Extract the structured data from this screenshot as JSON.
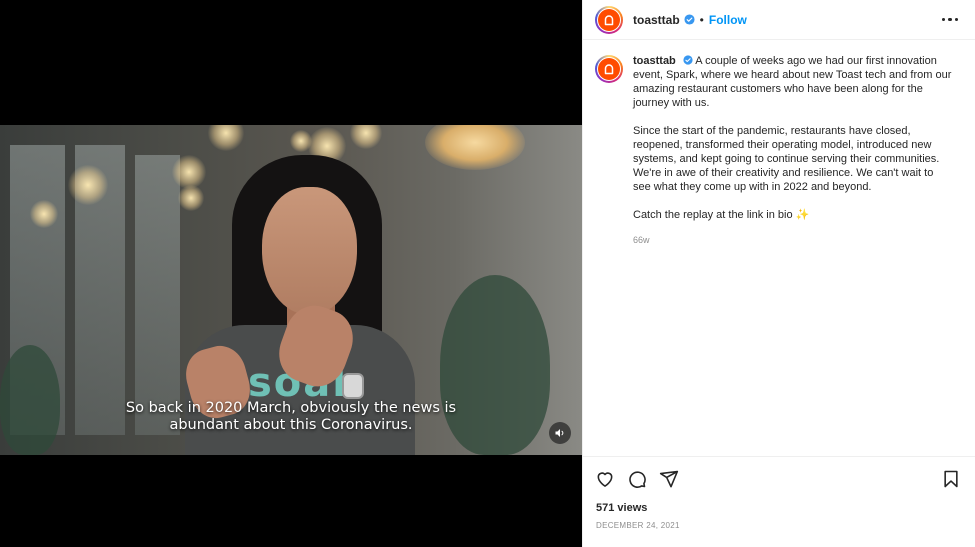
{
  "video": {
    "caption_line1": "So back in 2020 March, obviously the news is",
    "caption_line2": "abundant about this Coronavirus.",
    "shirt_text": "soak",
    "audio_icon": "speaker-icon"
  },
  "header": {
    "username": "toasttab",
    "separator": "•",
    "follow_label": "Follow",
    "more_icon": "more-options-icon"
  },
  "post": {
    "username": "toasttab",
    "paragraph1": "A couple of weeks ago we had our first innovation event, Spark, where we heard about new Toast tech and from our amazing restaurant customers who have been along for the journey with us.",
    "paragraph2": "Since the start of the pandemic, restaurants have closed, reopened, transformed their operating model, introduced new systems, and kept going to continue serving their communities. We're in awe of their creativity and resilience. We can't wait to see what they come up with in 2022 and beyond.",
    "paragraph3": "Catch the replay at the link in bio ✨",
    "time_ago": "66w"
  },
  "actions": {
    "icons": [
      "heart-icon",
      "comment-icon",
      "share-icon",
      "bookmark-icon"
    ],
    "views": "571 views",
    "date": "DECEMBER 24, 2021"
  },
  "colors": {
    "accent": "#0095f6",
    "brand": "#ff4c00",
    "verified": "#3897f0",
    "text": "#262626",
    "muted": "#8e8e8e"
  }
}
